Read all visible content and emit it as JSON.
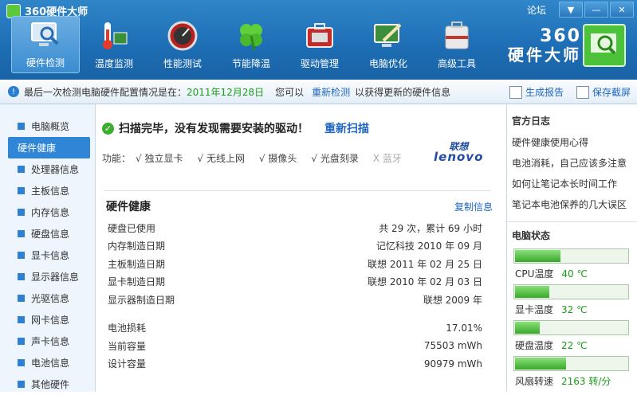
{
  "app": {
    "title": "360硬件大师",
    "forum": "论坛"
  },
  "window_controls": [
    "▼",
    "—",
    "✕"
  ],
  "nav": [
    {
      "label": "硬件检测",
      "icon": "monitor-magnifier-icon",
      "active": true
    },
    {
      "label": "温度监测",
      "icon": "thermometer-icon"
    },
    {
      "label": "性能测试",
      "icon": "speedometer-icon"
    },
    {
      "label": "节能降温",
      "icon": "clover-icon"
    },
    {
      "label": "驱动管理",
      "icon": "toolbox-icon"
    },
    {
      "label": "电脑优化",
      "icon": "monitor-brush-icon"
    },
    {
      "label": "高级工具",
      "icon": "toolkit-icon"
    }
  ],
  "brand": {
    "name": "360",
    "sub": "硬件大师"
  },
  "infobar": {
    "prefix": "最后一次检测电脑硬件配置情况是在：",
    "date": "2011年12月28日",
    "middle": "您可以",
    "recheck": "重新检测",
    "suffix": "以获得更新的硬件信息",
    "report": "生成报告",
    "screenshot": "保存截屏"
  },
  "sidebar": {
    "items": [
      "电脑概览",
      "硬件健康",
      "处理器信息",
      "主板信息",
      "内存信息",
      "硬盘信息",
      "显卡信息",
      "显示器信息",
      "光驱信息",
      "网卡信息",
      "声卡信息",
      "电池信息",
      "其他硬件"
    ]
  },
  "main": {
    "status": "扫描完毕，没有发现需要安装的驱动！",
    "rescan": "重新扫描",
    "features_label": "功能：",
    "features": [
      {
        "label": "√ 独立显卡",
        "on": true
      },
      {
        "label": "√ 无线上网",
        "on": true
      },
      {
        "label": "√ 摄像头",
        "on": true
      },
      {
        "label": "√ 光盘刻录",
        "on": true
      },
      {
        "label": "X 蓝牙",
        "on": false
      }
    ],
    "vendor": {
      "cn": "联想",
      "en": "lenovo"
    },
    "section_title": "硬件健康",
    "copy": "复制信息",
    "rows": [
      {
        "label": "硬盘已使用",
        "value": "共 29 次，累计 69 小时"
      },
      {
        "label": "内存制造日期",
        "value": "记忆科技 2010 年 09 月"
      },
      {
        "label": "主板制造日期",
        "value": "联想 2011 年 02 月 25 日"
      },
      {
        "label": "显卡制造日期",
        "value": "联想 2010 年 02 月 03 日"
      },
      {
        "label": "显示器制造日期",
        "value": "联想 2009 年"
      }
    ],
    "battery_rows": [
      {
        "label": "电池损耗",
        "value": "17.01%"
      },
      {
        "label": "当前容量",
        "value": "75503 mWh"
      },
      {
        "label": "设计容量",
        "value": "90979 mWh"
      }
    ]
  },
  "right": {
    "log_title": "官方日志",
    "log_items": [
      "硬件健康使用心得",
      "电池消耗，自己应该多注意",
      "如何让笔记本长时间工作",
      "笔记本电池保养的几大误区"
    ],
    "state_title": "电脑状态",
    "meters": [
      {
        "label": "CPU温度",
        "value": "40 ℃",
        "fill": 0.4
      },
      {
        "label": "显卡温度",
        "value": "32 ℃",
        "fill": 0.3
      },
      {
        "label": "硬盘温度",
        "value": "22 ℃",
        "fill": 0.22
      },
      {
        "label": "风扇转速",
        "value": "2163 转/分",
        "fill": 0.45
      }
    ]
  },
  "colors": {
    "title_blue": "#1d6db4",
    "accent_green": "#1a9c1a",
    "link_blue": "#1f66c2",
    "sidebar_active": "#2f86d6"
  }
}
